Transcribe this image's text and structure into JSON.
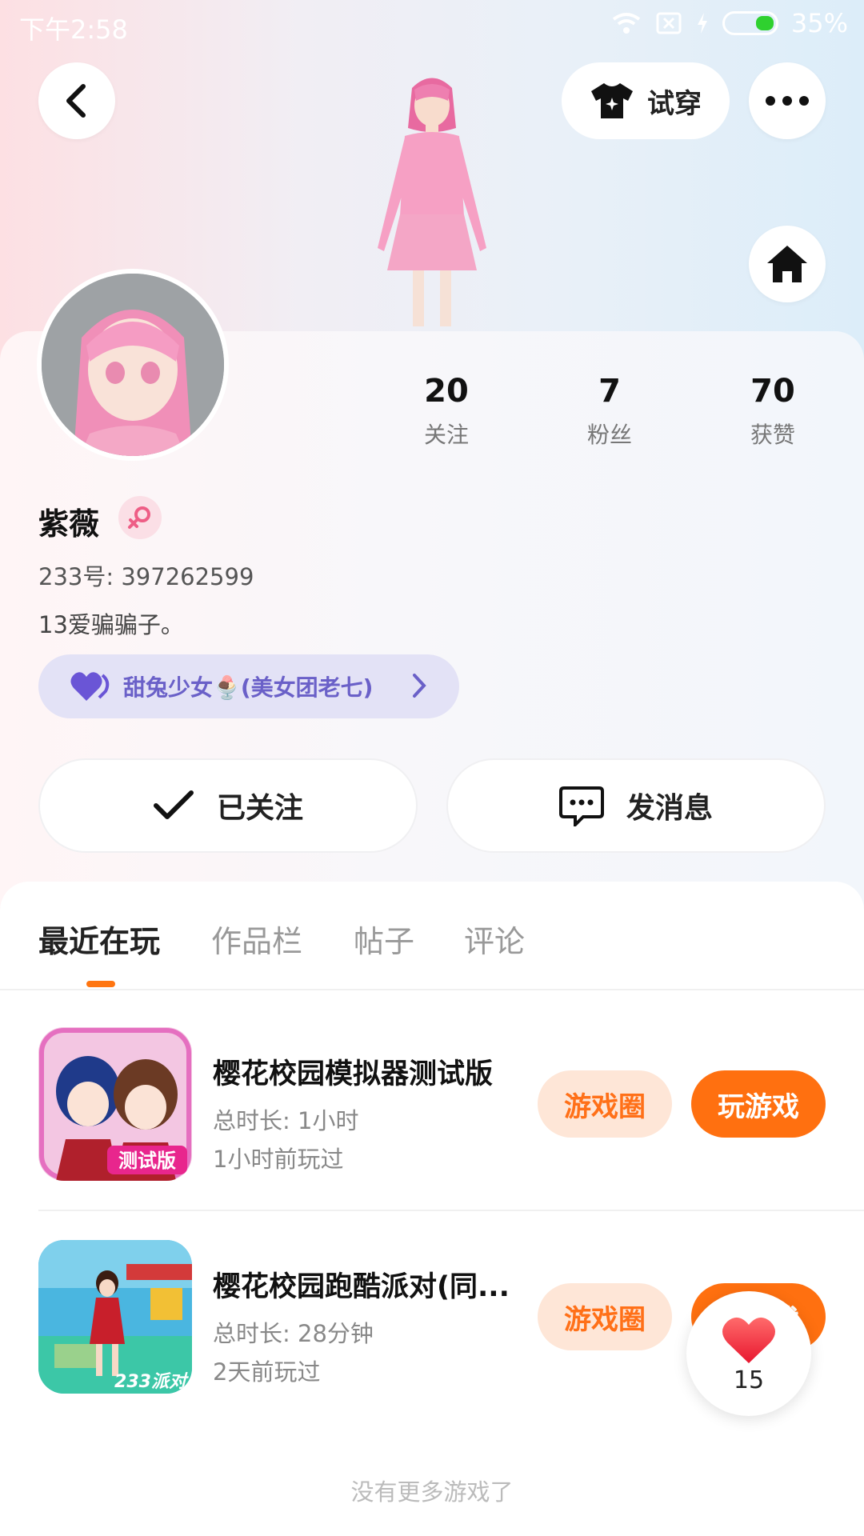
{
  "status_bar": {
    "time": "下午2:58",
    "battery": "35%"
  },
  "header": {
    "try_on_label": "试穿"
  },
  "profile": {
    "name": "紫薇",
    "id_line": "233号: 397262599",
    "bio": "13爱骗骗子。",
    "group_label": "甜兔少女🍨(美女团老七)",
    "stats": [
      {
        "value": "20",
        "label": "关注"
      },
      {
        "value": "7",
        "label": "粉丝"
      },
      {
        "value": "70",
        "label": "获赞"
      }
    ]
  },
  "actions": {
    "following_label": "已关注",
    "message_label": "发消息"
  },
  "tabs": [
    {
      "label": "最近在玩",
      "active": true
    },
    {
      "label": "作品栏",
      "active": false
    },
    {
      "label": "帖子",
      "active": false
    },
    {
      "label": "评论",
      "active": false
    }
  ],
  "games": [
    {
      "title": "樱花校园模拟器测试版",
      "duration": "总时长: 1小时",
      "last_played": "1小时前玩过",
      "icon_text": "测试版",
      "circle_label": "游戏圈",
      "play_label": "玩游戏"
    },
    {
      "title": "樱花校园跑酷派对(同...",
      "duration": "总时长: 28分钟",
      "last_played": "2天前玩过",
      "icon_text": "233派对",
      "circle_label": "游戏圈",
      "play_label": "玩游戏"
    }
  ],
  "like_float": {
    "count": "15"
  },
  "footer": {
    "no_more": "没有更多游戏了"
  },
  "colors": {
    "accent": "#ff7010",
    "accent_light": "#fee6d7",
    "group_pill": "#e3e2f6",
    "group_text": "#6a60c8"
  }
}
